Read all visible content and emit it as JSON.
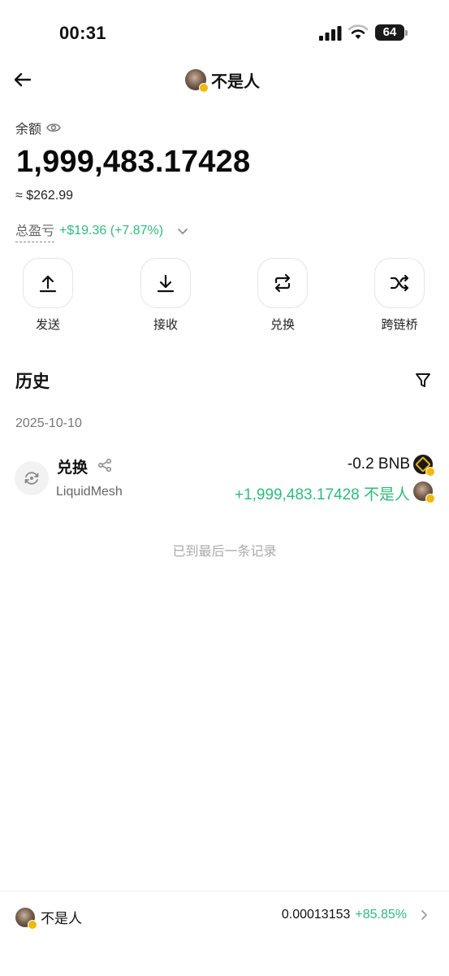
{
  "status_bar": {
    "time": "00:31",
    "battery": "64"
  },
  "header": {
    "token_name": "不是人"
  },
  "balance": {
    "label": "余额",
    "amount": "1,999,483.17428",
    "usd": "≈ $262.99",
    "pnl_label": "总盈亏",
    "pnl_value": "+$19.36 (+7.87%)"
  },
  "actions": [
    {
      "label": "发送",
      "icon": "upload-icon"
    },
    {
      "label": "接收",
      "icon": "download-icon"
    },
    {
      "label": "兑换",
      "icon": "swap-icon"
    },
    {
      "label": "跨链桥",
      "icon": "bridge-icon"
    }
  ],
  "history": {
    "title": "历史",
    "date": "2025-10-10",
    "transactions": [
      {
        "type": "兑换",
        "protocol": "LiquidMesh",
        "out_amount": "-0.2 BNB",
        "in_amount": "+1,999,483.17428 不是人"
      }
    ],
    "end_text": "已到最后一条记录"
  },
  "footer": {
    "token_name": "不是人",
    "price": "0.00013153",
    "change": "+85.85%"
  },
  "colors": {
    "positive": "#2fba7d",
    "badge": "#f0b90b"
  }
}
